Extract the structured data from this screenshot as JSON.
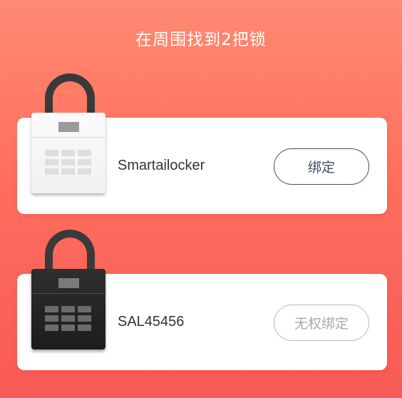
{
  "header": {
    "title": "在周围找到2把锁"
  },
  "devices": [
    {
      "name": "Smartailocker",
      "lock_color": "white",
      "action_label": "绑定",
      "action_enabled": true
    },
    {
      "name": "SAL45456",
      "lock_color": "black",
      "action_label": "无权绑定",
      "action_enabled": false
    }
  ],
  "colors": {
    "background_top": "#ff8a72",
    "background_bottom": "#f85a55",
    "bind_button": "#3f4d66",
    "disabled_button": "#b9b9b9"
  }
}
